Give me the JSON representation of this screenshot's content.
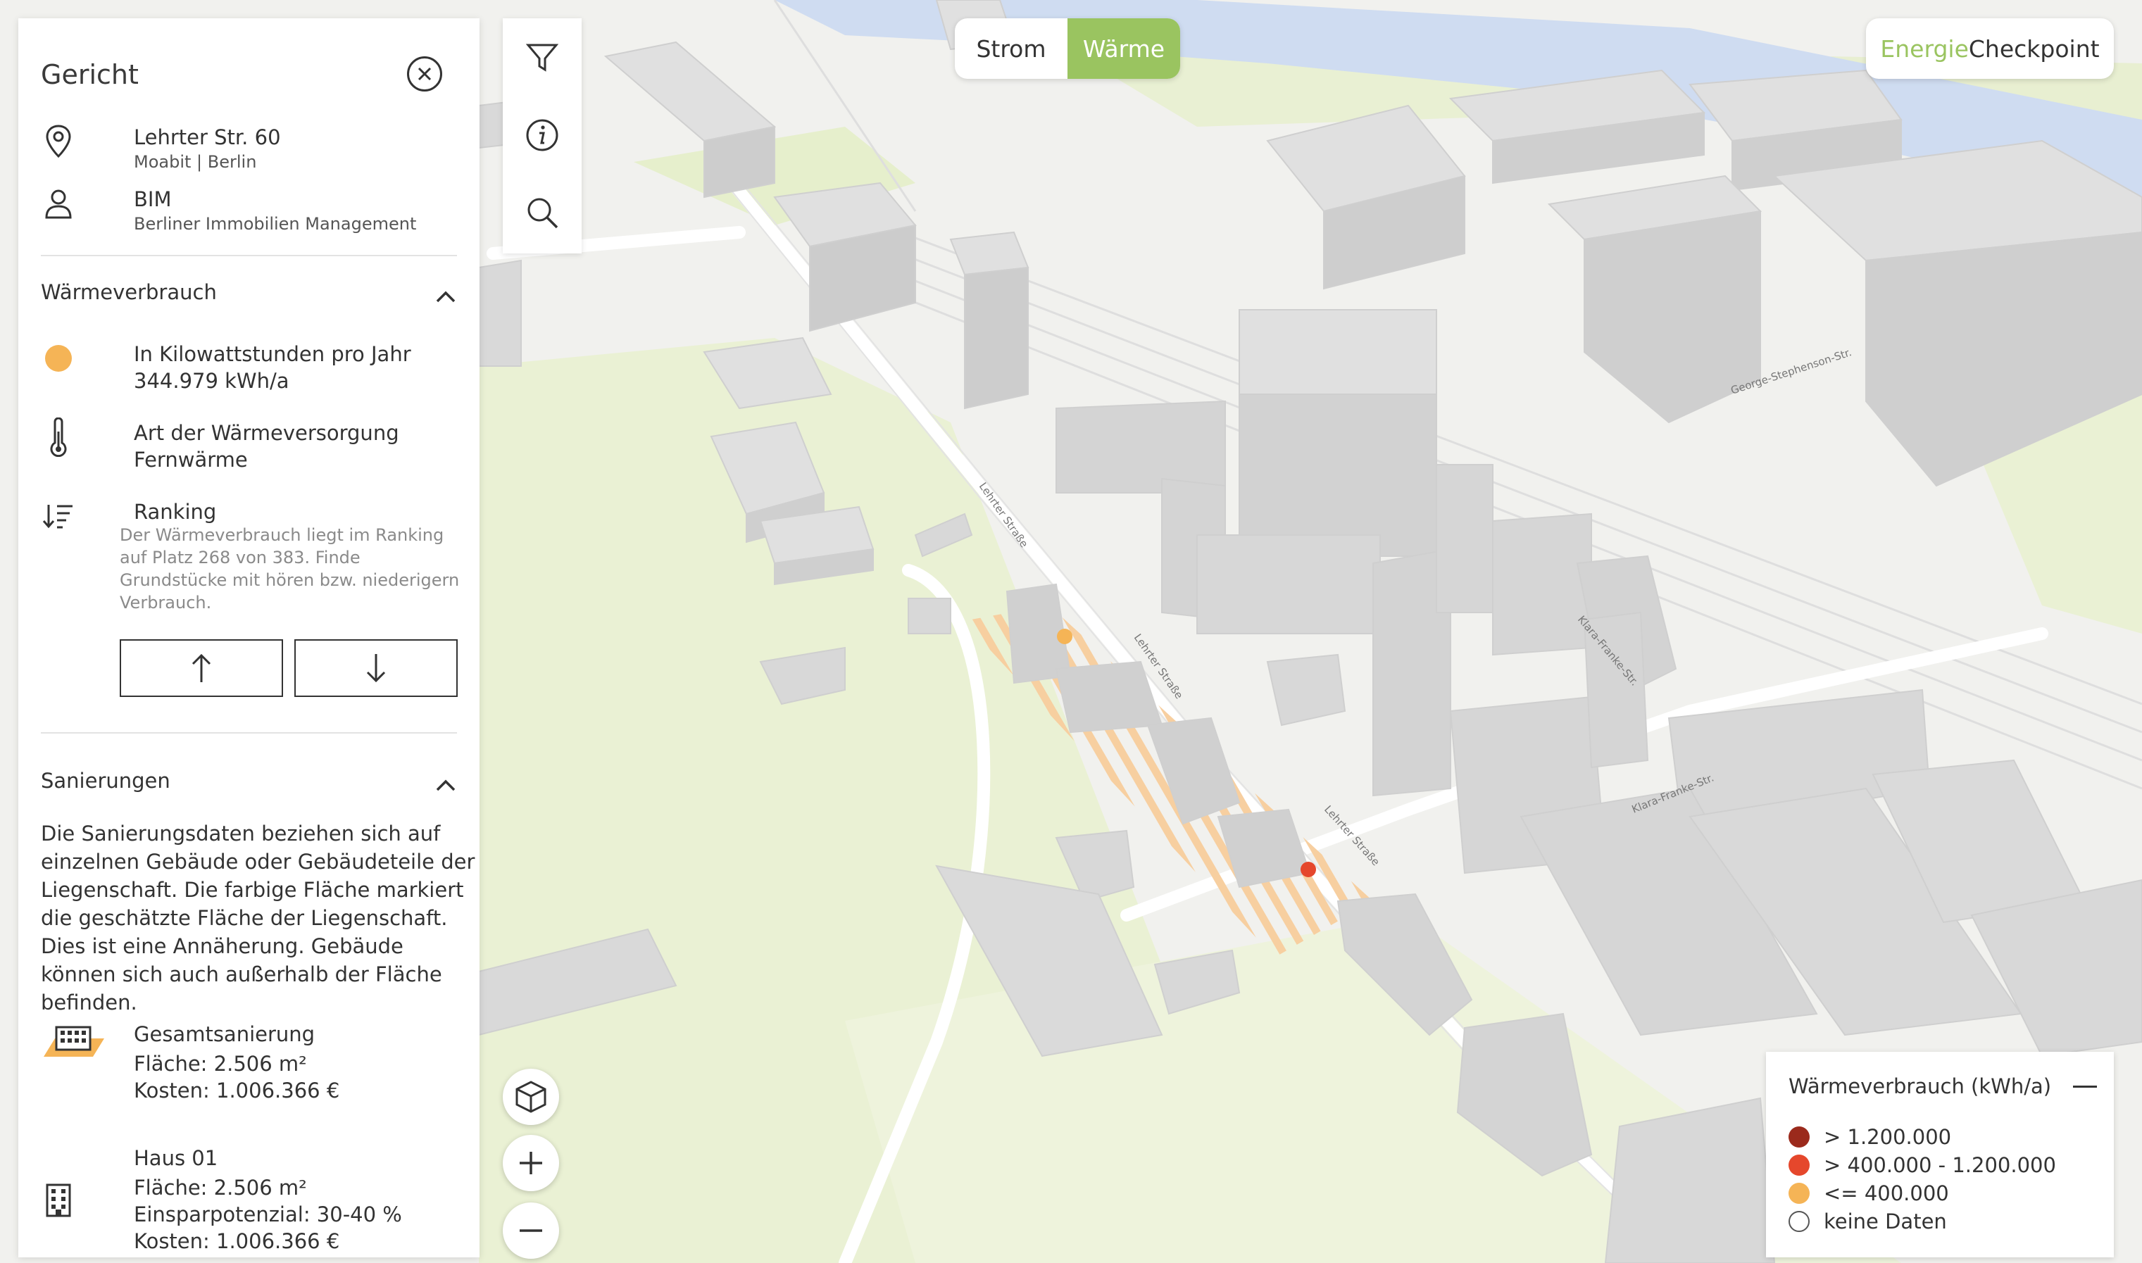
{
  "panel": {
    "title": "Gericht",
    "address": {
      "street": "Lehrter Str. 60",
      "district": "Moabit | Berlin"
    },
    "owner": {
      "short": "BIM",
      "full": "Berliner Immobilien Management"
    },
    "waerme": {
      "title": "Wärmeverbrauch",
      "unit_label": "In Kilowattstunden pro Jahr",
      "value": "344.979 kWh/a",
      "supply_label": "Art der Wärmeversorgung",
      "supply_value": "Fernwärme",
      "ranking_label": "Ranking",
      "ranking_text": "Der Wärmeverbrauch liegt im Ranking auf Platz 268 von 383. Finde Grundstücke mit hören bzw. niederigern Verbrauch."
    },
    "sanierungen": {
      "title": "Sanierungen",
      "text": "Die Sanierungsdaten beziehen sich auf einzelnen Gebäude oder Gebäudeteile der Liegenschaft. Die farbige Fläche markiert die geschätzte Fläche der Liegenschaft. Dies ist eine Annäherung. Gebäude können sich auch außerhalb der Fläche befinden.",
      "items": [
        {
          "name": "Gesamtsanierung",
          "area": "Fläche: 2.506 m²",
          "cost": "Kosten: 1.006.366 €"
        },
        {
          "name": "Haus 01",
          "area": "Fläche: 2.506 m²",
          "saving": "Einsparpotenzial: 30-40 %",
          "cost": "Kosten: 1.006.366 €"
        }
      ]
    }
  },
  "toggle": {
    "strom": "Strom",
    "waerme": "Wärme"
  },
  "brand": {
    "part1": "Energie",
    "part2": "Checkpoint",
    "color1": "#9ac460"
  },
  "legend": {
    "title": "Wärmeverbrauch (kWh/a)",
    "items": [
      {
        "label": "> 1.200.000",
        "color": "#9b2a1c"
      },
      {
        "label": "> 400.000 - 1.200.000",
        "color": "#e5472c"
      },
      {
        "label": "<= 400.000",
        "color": "#f5b456"
      },
      {
        "label": "keine Daten",
        "color": "#ffffff"
      }
    ]
  },
  "map_labels": {
    "street_lehrter": "Lehrter Straße",
    "street_klara": "Klara-Franke-Str.",
    "street_george": "George-Stephenson-Str."
  },
  "icons": [
    "location-pin-icon",
    "person-icon",
    "close-icon",
    "chevron-up-icon",
    "thermometer-icon",
    "sort-icon",
    "arrow-up-icon",
    "arrow-down-icon",
    "filter-icon",
    "info-icon",
    "search-icon",
    "cube-icon",
    "plus-icon",
    "minus-icon",
    "building-icon"
  ]
}
